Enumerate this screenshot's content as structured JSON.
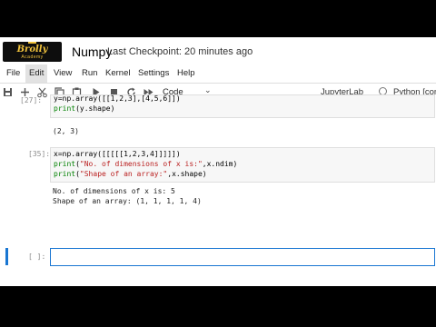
{
  "header": {
    "logo_main": "Brolly",
    "logo_sub": "Academy",
    "notebook_title": "Numpy",
    "checkpoint": "Last Checkpoint: 20 minutes ago"
  },
  "menubar": [
    "File",
    "Edit",
    "View",
    "Run",
    "Kernel",
    "Settings",
    "Help"
  ],
  "menubar_active": "Edit",
  "toolbar": {
    "icons": [
      "save-icon",
      "add-cell-icon",
      "cut-icon",
      "copy-icon",
      "paste-icon",
      "run-icon",
      "stop-icon",
      "restart-icon",
      "fast-forward-icon"
    ],
    "cell_type": "Code",
    "jupyterlab_label": "JupyterLab",
    "kernel_name": "Python [con"
  },
  "cells": {
    "cell1": {
      "prompt": "[27]:",
      "line1": "y=np.array([[1,2,3],[4,5,6]])",
      "line2_fn": "print",
      "line2_rest": "(y.shape)",
      "output": "(2, 3)"
    },
    "cell2": {
      "prompt": "[35]:",
      "line1": "x=np.array([[[[[1,2,3,4]]]]])",
      "line2_fn": "print",
      "line2_str": "\"No. of dimensions of x is:\"",
      "line2_rest": ",x.ndim)",
      "line3_fn": "print",
      "line3_str": "\"Shape of an array:\"",
      "line3_rest": ",x.shape)",
      "output1": "No. of dimensions of x is: 5",
      "output2": "Shape of an array: (1, 1, 1, 1, 4)"
    },
    "active": {
      "prompt": "[ ]:"
    }
  },
  "colors": {
    "accent": "#1976d2",
    "keyword": "#008000",
    "string": "#ba2121",
    "logo_bg": "#0d0d0d",
    "logo_text": "#f0c23c"
  }
}
